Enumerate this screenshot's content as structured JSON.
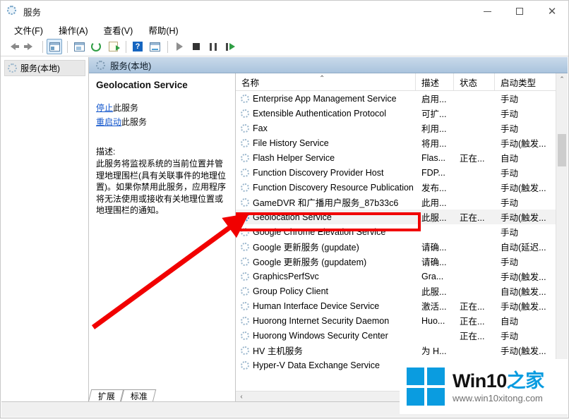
{
  "window": {
    "title": "服务",
    "icon": "services-gear-icon",
    "minimize": "minimize",
    "maximize": "maximize",
    "close": "close"
  },
  "menubar": [
    {
      "label": "文件(F)",
      "name": "menu-file"
    },
    {
      "label": "操作(A)",
      "name": "menu-action"
    },
    {
      "label": "查看(V)",
      "name": "menu-view"
    },
    {
      "label": "帮助(H)",
      "name": "menu-help"
    }
  ],
  "toolbar": [
    {
      "name": "back-button",
      "icon": "arrow-left-icon"
    },
    {
      "name": "forward-button",
      "icon": "arrow-right-icon"
    },
    {
      "name": "show-hide-console-tree-button",
      "icon": "console-tree-icon"
    },
    {
      "name": "show-hide-action-pane-button",
      "icon": "action-pane-icon"
    },
    {
      "name": "refresh-button",
      "icon": "refresh-icon"
    },
    {
      "name": "export-list-button",
      "icon": "export-icon"
    },
    {
      "name": "help-button",
      "icon": "help-icon"
    },
    {
      "name": "show-hide-details-button",
      "icon": "details-pane-icon"
    },
    {
      "name": "start-service-button",
      "icon": "play-icon"
    },
    {
      "name": "stop-service-button",
      "icon": "stop-icon"
    },
    {
      "name": "pause-service-button",
      "icon": "pause-icon"
    },
    {
      "name": "restart-service-button",
      "icon": "restart-icon"
    }
  ],
  "tree": {
    "root_label": "服务(本地)"
  },
  "pane_header": {
    "label": "服务(本地)"
  },
  "detail": {
    "service_name": "Geolocation Service",
    "stop_link": "停止",
    "stop_suffix": "此服务",
    "restart_link": "重启动",
    "restart_suffix": "此服务",
    "description_label": "描述:",
    "description_text": "此服务将监视系统的当前位置并管理地理围栏(具有关联事件的地理位置)。如果你禁用此服务，应用程序将无法使用或接收有关地理位置或地理围栏的通知。"
  },
  "columns": [
    {
      "label": "名称",
      "name": "column-header-name",
      "sort": "ascending"
    },
    {
      "label": "描述",
      "name": "column-header-description"
    },
    {
      "label": "状态",
      "name": "column-header-status"
    },
    {
      "label": "启动类型",
      "name": "column-header-startup-type"
    }
  ],
  "rows": [
    {
      "name": "Enterprise App Management Service",
      "desc": "启用...",
      "state": "",
      "start": "手动",
      "selected": false
    },
    {
      "name": "Extensible Authentication Protocol",
      "desc": "可扩...",
      "state": "",
      "start": "手动",
      "selected": false
    },
    {
      "name": "Fax",
      "desc": "利用...",
      "state": "",
      "start": "手动",
      "selected": false
    },
    {
      "name": "File History Service",
      "desc": "将用...",
      "state": "",
      "start": "手动(触发...",
      "selected": false
    },
    {
      "name": "Flash Helper Service",
      "desc": "Flas...",
      "state": "正在...",
      "start": "自动",
      "selected": false
    },
    {
      "name": "Function Discovery Provider Host",
      "desc": "FDP...",
      "state": "",
      "start": "手动",
      "selected": false
    },
    {
      "name": "Function Discovery Resource Publication",
      "desc": "发布...",
      "state": "",
      "start": "手动(触发...",
      "selected": false
    },
    {
      "name": "GameDVR 和广播用户服务_87b33c6",
      "desc": "此用...",
      "state": "",
      "start": "手动",
      "selected": false
    },
    {
      "name": "Geolocation Service",
      "desc": "此服...",
      "state": "正在...",
      "start": "手动(触发...",
      "selected": true
    },
    {
      "name": "Google Chrome Elevation Service",
      "desc": "",
      "state": "",
      "start": "手动",
      "selected": false
    },
    {
      "name": "Google 更新服务 (gupdate)",
      "desc": "请确...",
      "state": "",
      "start": "自动(延迟...",
      "selected": false
    },
    {
      "name": "Google 更新服务 (gupdatem)",
      "desc": "请确...",
      "state": "",
      "start": "手动",
      "selected": false
    },
    {
      "name": "GraphicsPerfSvc",
      "desc": "Gra...",
      "state": "",
      "start": "手动(触发...",
      "selected": false
    },
    {
      "name": "Group Policy Client",
      "desc": "此服...",
      "state": "",
      "start": "自动(触发...",
      "selected": false
    },
    {
      "name": "Human Interface Device Service",
      "desc": "激活...",
      "state": "正在...",
      "start": "手动(触发...",
      "selected": false
    },
    {
      "name": "Huorong Internet Security Daemon",
      "desc": "Huo...",
      "state": "正在...",
      "start": "自动",
      "selected": false
    },
    {
      "name": "Huorong Windows Security Center",
      "desc": "",
      "state": "正在...",
      "start": "手动",
      "selected": false
    },
    {
      "name": "HV 主机服务",
      "desc": "为 H...",
      "state": "",
      "start": "手动(触发...",
      "selected": false
    },
    {
      "name": "Hyper-V Data Exchange Service",
      "desc": "",
      "state": "",
      "start": "",
      "selected": false
    }
  ],
  "scrollbars": {
    "vertical_up_glyph": "⌃",
    "horizontal_left_glyph": "‹"
  },
  "tabs": [
    {
      "label": "扩展",
      "name": "tab-extended"
    },
    {
      "label": "标准",
      "name": "tab-standard"
    }
  ],
  "annotation": {
    "highlight_color": "#f10000",
    "arrow_color": "#f10000",
    "target_row": "Geolocation Service"
  },
  "watermark": {
    "brand_main": "Win10",
    "brand_suffix": "之家",
    "url": "www.win10xitong.com",
    "logo_color": "#0a9ce0"
  }
}
